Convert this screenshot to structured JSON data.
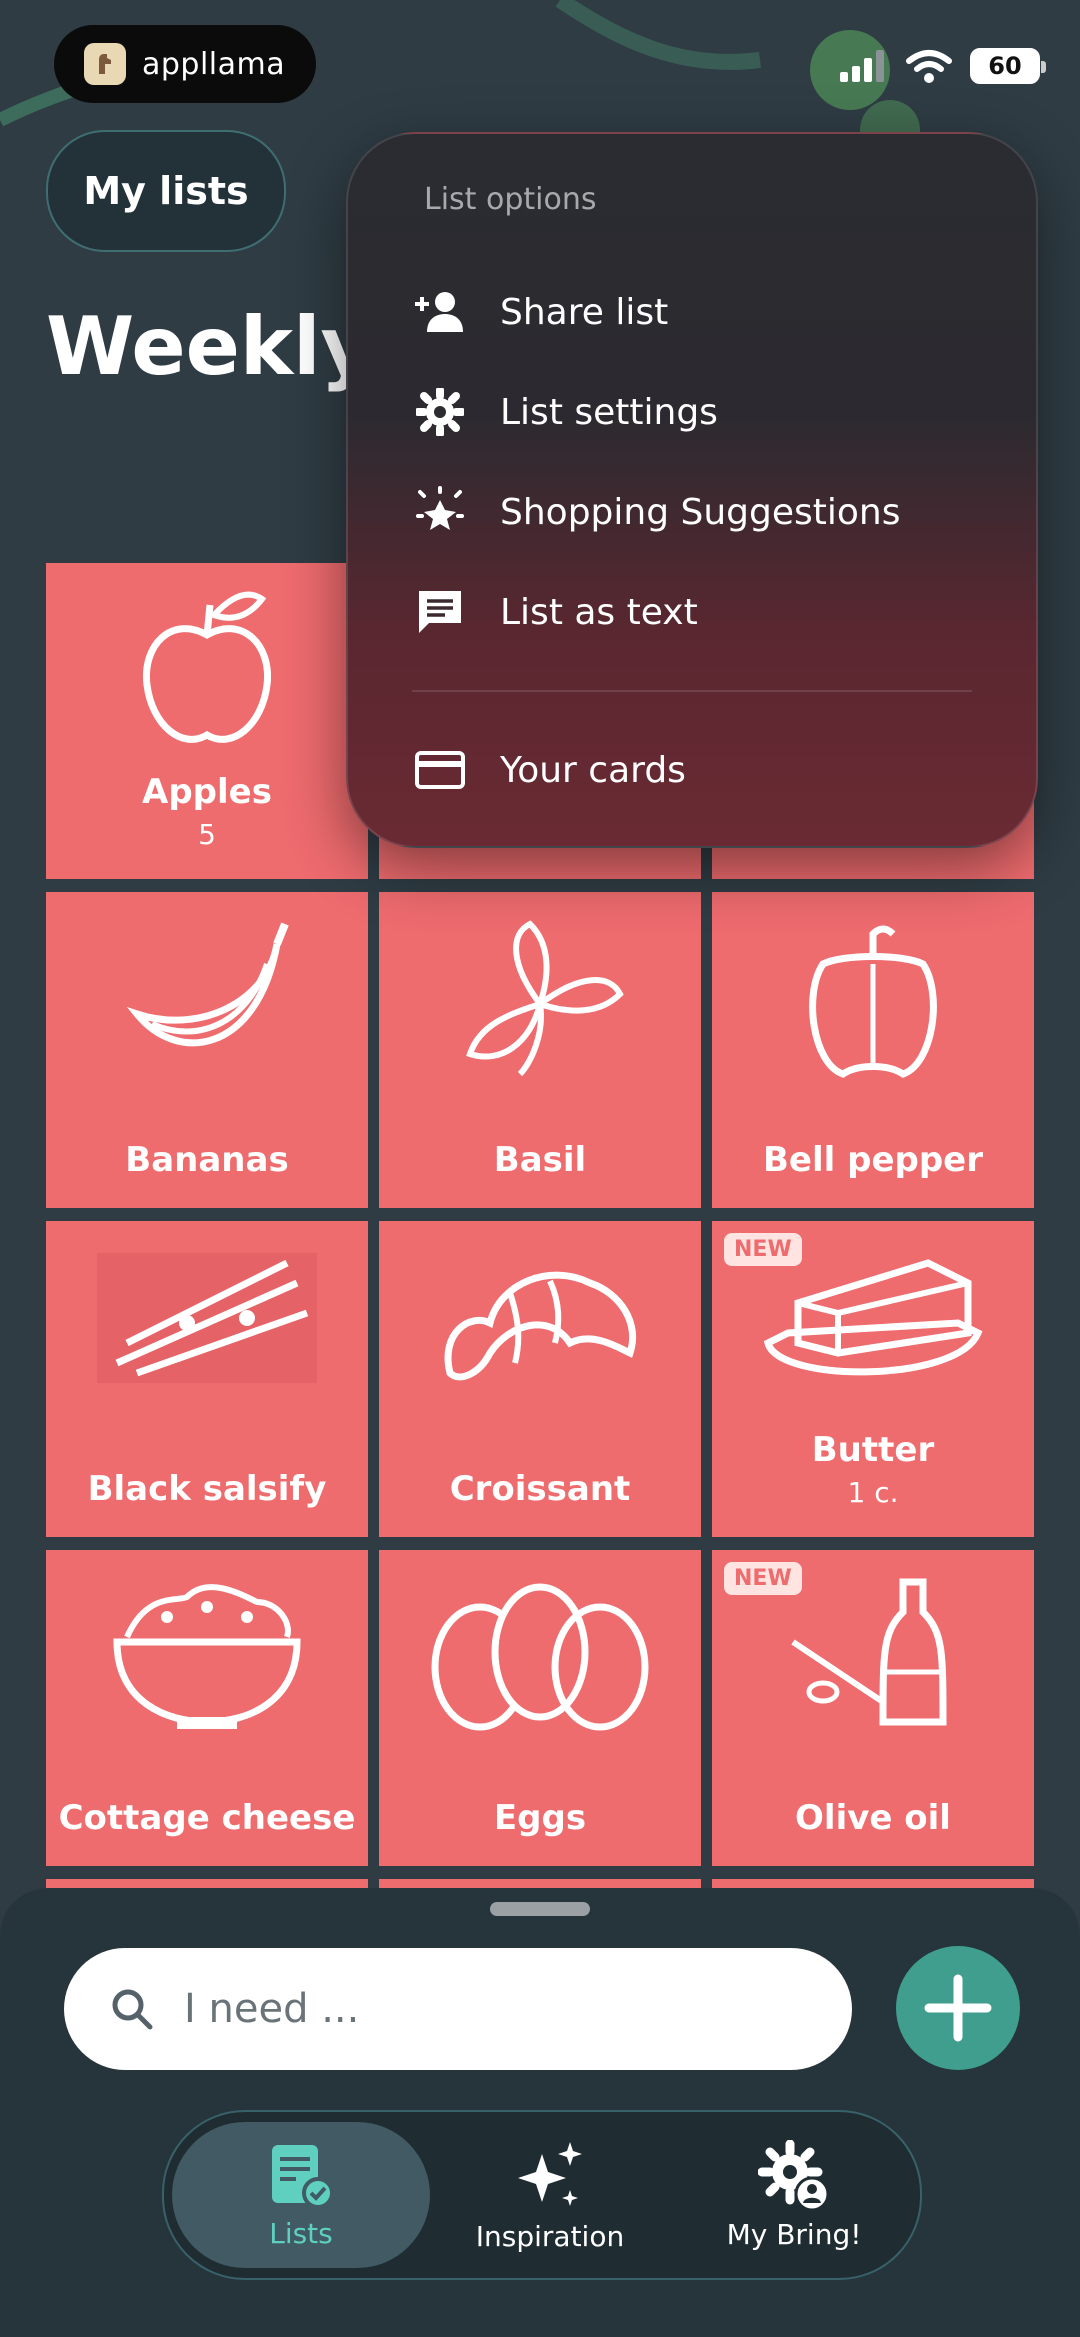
{
  "status_bar": {
    "app_pill": "appllama",
    "battery": "60"
  },
  "header": {
    "my_lists": "My lists",
    "title": "Weekly"
  },
  "menu": {
    "header": "List options",
    "items": [
      {
        "label": "Share list",
        "icon": "add-person-icon"
      },
      {
        "label": "List settings",
        "icon": "gear-icon"
      },
      {
        "label": "Shopping Suggestions",
        "icon": "sparkle-icon"
      },
      {
        "label": "List as text",
        "icon": "chat-text-icon"
      },
      {
        "label": "Your cards",
        "icon": "card-icon"
      }
    ]
  },
  "tiles": [
    {
      "name": "Apples",
      "qty": "5",
      "icon": "apple-icon"
    },
    {
      "name": "Bananas",
      "qty": "",
      "icon": "banana-icon"
    },
    {
      "name": "Basil",
      "qty": "",
      "icon": "basil-icon"
    },
    {
      "name": "Bell pepper",
      "qty": "",
      "icon": "bell-pepper-icon"
    },
    {
      "name": "Black salsify",
      "qty": "",
      "icon": "salsify-icon"
    },
    {
      "name": "Croissant",
      "qty": "",
      "icon": "croissant-icon"
    },
    {
      "name": "Butter",
      "qty": "1 c.",
      "icon": "butter-icon",
      "badge": "NEW"
    },
    {
      "name": "Cottage cheese",
      "qty": "",
      "icon": "bowl-icon"
    },
    {
      "name": "Eggs",
      "qty": "",
      "icon": "eggs-icon"
    },
    {
      "name": "Olive oil",
      "qty": "",
      "icon": "olive-oil-icon",
      "badge": "NEW"
    }
  ],
  "search": {
    "placeholder": "I need ..."
  },
  "tabs": [
    {
      "label": "Lists",
      "icon": "list-check-icon",
      "active": true
    },
    {
      "label": "Inspiration",
      "icon": "sparkles-icon",
      "active": false
    },
    {
      "label": "My Bring!",
      "icon": "gear-person-icon",
      "active": false
    }
  ],
  "colors": {
    "tile": "#ee6b6e",
    "accent": "#3f9e8e",
    "background": "#2f3c44"
  }
}
